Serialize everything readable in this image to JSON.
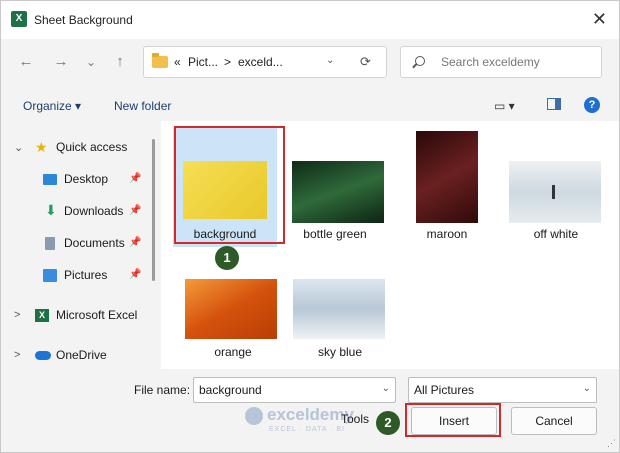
{
  "window": {
    "title": "Sheet Background",
    "app_icon": "excel-icon"
  },
  "nav": {
    "back": "←",
    "forward": "→",
    "history": "⌄",
    "up": "↑",
    "refresh": "⟳"
  },
  "address": {
    "segments": [
      "«",
      "Pict...",
      ">",
      "exceld..."
    ]
  },
  "search": {
    "placeholder": "Search exceldemy"
  },
  "toolbar": {
    "organize": "Organize ▾",
    "new_folder": "New folder",
    "view": "▭ ▾",
    "help": "?"
  },
  "sidebar": {
    "items": [
      {
        "label": "Quick access",
        "icon": "star-icon",
        "chevron": "⌄",
        "pinned": false
      },
      {
        "label": "Desktop",
        "icon": "desktop-icon",
        "pinned": true
      },
      {
        "label": "Downloads",
        "icon": "download-icon",
        "pinned": true
      },
      {
        "label": "Documents",
        "icon": "documents-icon",
        "pinned": true
      },
      {
        "label": "Pictures",
        "icon": "pictures-icon",
        "pinned": true
      },
      {
        "label": "Microsoft Excel",
        "icon": "excel-icon",
        "chevron": ">"
      },
      {
        "label": "OneDrive",
        "icon": "cloud-icon",
        "chevron": ">"
      }
    ]
  },
  "files": [
    {
      "name": "background",
      "selected": true,
      "color": "#f2d23a"
    },
    {
      "name": "bottle green",
      "selected": false,
      "color": "#1f4a2c"
    },
    {
      "name": "maroon",
      "selected": false,
      "color": "#4a1414"
    },
    {
      "name": "off white",
      "selected": false,
      "color": "#dde4ea"
    },
    {
      "name": "orange",
      "selected": false,
      "color": "#e8701c"
    },
    {
      "name": "sky blue",
      "selected": false,
      "color": "#c9d9e6"
    }
  ],
  "callouts": {
    "step1": "1",
    "step2": "2"
  },
  "bottom": {
    "file_name_label": "File name:",
    "file_name_value": "background",
    "file_type": "All Pictures",
    "tools": "Tools",
    "insert": "Insert",
    "cancel": "Cancel"
  },
  "watermark": {
    "name": "exceldemy",
    "sub": "EXCEL · DATA · BI"
  },
  "colors": {
    "highlight": "#d12a2a",
    "badge": "#2d5a27",
    "selection": "#cce4f7",
    "link": "#1f3c72"
  }
}
